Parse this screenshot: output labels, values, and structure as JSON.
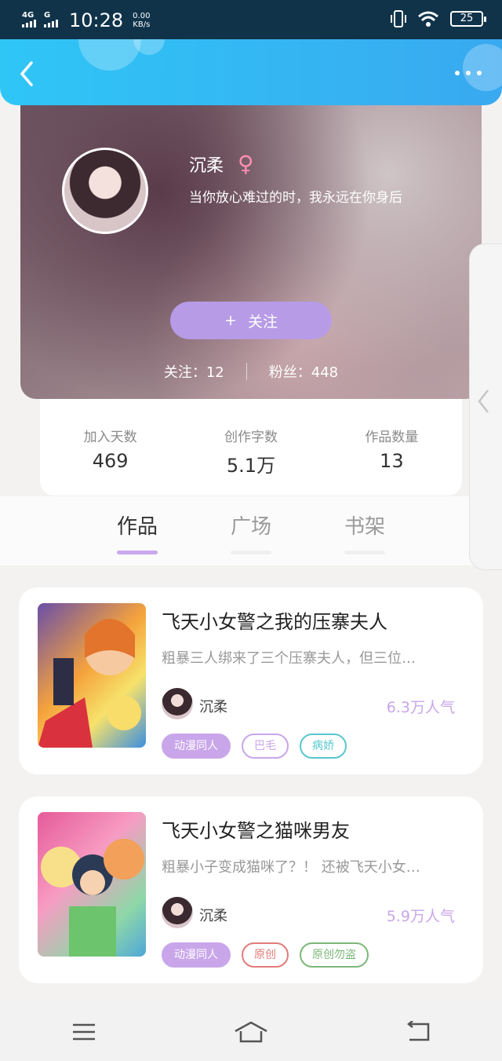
{
  "status_bar": {
    "network_1": "4G",
    "network_2": "G",
    "time": "10:28",
    "speed_value": "0.00",
    "speed_unit": "KB/s",
    "battery": "25"
  },
  "profile": {
    "name": "沉柔",
    "gender_icon": "female-icon",
    "signature": "当你放心难过的时，我永远在你身后",
    "follow_label": "关注",
    "following_text": "关注：12",
    "fans_text": "粉丝：448"
  },
  "stats": [
    {
      "label": "加入天数",
      "value": "469"
    },
    {
      "label": "创作字数",
      "value": "5.1万"
    },
    {
      "label": "作品数量",
      "value": "13"
    }
  ],
  "tabs": [
    {
      "label": "作品",
      "active": true
    },
    {
      "label": "广场",
      "active": false
    },
    {
      "label": "书架",
      "active": false
    }
  ],
  "books": [
    {
      "title": "飞天小女警之我的压寨夫人",
      "description": "粗暴三人绑来了三个压寨夫人，但三位…",
      "author": "沉柔",
      "popularity": "6.3万人气",
      "tags": [
        {
          "label": "动漫同人",
          "style": "filled",
          "color": "#c9a6ea"
        },
        {
          "label": "巴毛",
          "style": "outline",
          "color": "#c9a6ea"
        },
        {
          "label": "病娇",
          "style": "outline",
          "color": "#57c7cf"
        }
      ]
    },
    {
      "title": "飞天小女警之猫咪男友",
      "description": "粗暴小子变成猫咪了？！ 还被飞天小女…",
      "author": "沉柔",
      "popularity": "5.9万人气",
      "tags": [
        {
          "label": "动漫同人",
          "style": "filled",
          "color": "#c9a6ea"
        },
        {
          "label": "原创",
          "style": "outline",
          "color": "#e27b7b"
        },
        {
          "label": "原创勿盗",
          "style": "outline",
          "color": "#7bb878"
        }
      ]
    }
  ],
  "nav": [
    "menu-icon",
    "home-icon",
    "back-icon"
  ],
  "colors": {
    "accent": "#c9a6ea",
    "topbar": "#2fc6f6",
    "follow_button": "#b79be6"
  }
}
